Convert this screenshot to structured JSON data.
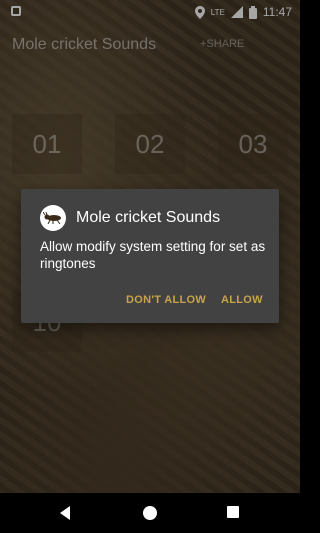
{
  "status_bar": {
    "time": "11:47",
    "network": "LTE"
  },
  "app_bar": {
    "title": "Mole cricket Sounds",
    "share_label": "+SHARE"
  },
  "tiles": [
    "01",
    "02",
    "03",
    "10"
  ],
  "dialog": {
    "title": "Mole cricket Sounds",
    "message": "Allow modify system setting for set as ringtones",
    "deny_label": "DON'T ALLOW",
    "allow_label": "ALLOW"
  },
  "colors": {
    "dialog_bg": "#424242",
    "dialog_button": "#c7a44a",
    "nav_bar": "#000000"
  }
}
